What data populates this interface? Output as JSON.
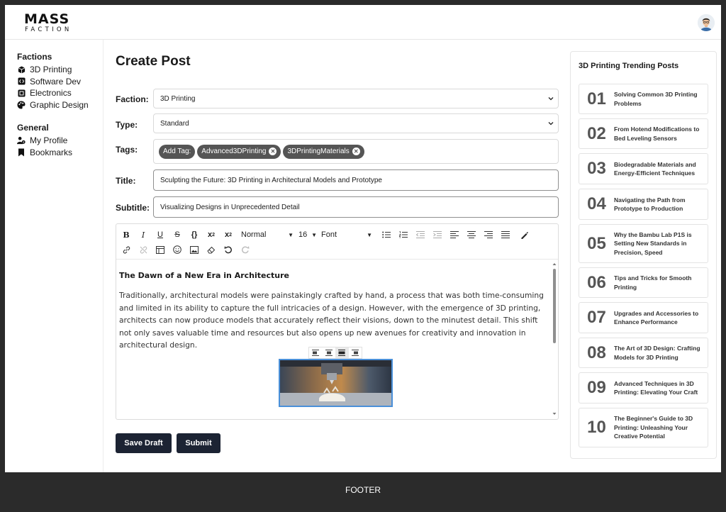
{
  "app": {
    "logo_line1": "MASS",
    "logo_line2": "FACTION"
  },
  "sidebar": {
    "factions_heading": "Factions",
    "factions": [
      {
        "label": "3D Printing",
        "icon": "cube-icon"
      },
      {
        "label": "Software Dev",
        "icon": "code-icon"
      },
      {
        "label": "Electronics",
        "icon": "chip-icon"
      },
      {
        "label": "Graphic Design",
        "icon": "palette-icon"
      }
    ],
    "general_heading": "General",
    "general": [
      {
        "label": "My Profile",
        "icon": "user-gear-icon"
      },
      {
        "label": "Bookmarks",
        "icon": "bookmark-icon"
      }
    ]
  },
  "form": {
    "page_title": "Create Post",
    "faction_label": "Faction:",
    "faction_value": "3D Printing",
    "type_label": "Type:",
    "type_value": "Standard",
    "tags_label": "Tags:",
    "add_tag_label": "Add Tag:",
    "tags": [
      "Advanced3DPrinting",
      "3DPrintingMaterials"
    ],
    "title_label": "Title:",
    "title_value": "Sculpting the Future: 3D Printing in Architectural Models and Prototype",
    "subtitle_label": "Subtitle:",
    "subtitle_value": "Visualizing Designs in Unprecedented Detail"
  },
  "toolbar": {
    "format_value": "Normal",
    "size_value": "16",
    "font_value": "Font"
  },
  "editor": {
    "heading": "The Dawn of a New Era in Architecture",
    "paragraph": "Traditionally, architectural models were painstakingly crafted by hand, a process that was both time-consuming and limited in its ability to capture the full intricacies of a design. However, with the emergence of 3D printing, architects can now produce models that accurately reflect their visions, down to the minutest detail. This shift not only saves valuable time and resources but also opens up new avenues for creativity and innovation in architectural design."
  },
  "actions": {
    "save_draft": "Save Draft",
    "submit": "Submit"
  },
  "trending": {
    "heading": "3D Printing Trending Posts",
    "items": [
      {
        "num": "01",
        "title": "Solving Common 3D Printing Problems"
      },
      {
        "num": "02",
        "title": "From Hotend Modifications to Bed Leveling Sensors"
      },
      {
        "num": "03",
        "title": "Biodegradable Materials and Energy-Efficient Techniques"
      },
      {
        "num": "04",
        "title": "Navigating the Path from Prototype to Production"
      },
      {
        "num": "05",
        "title": "Why the Bambu Lab P1S is Setting New Standards in Precision, Speed"
      },
      {
        "num": "06",
        "title": "Tips and Tricks for Smooth Printing"
      },
      {
        "num": "07",
        "title": "Upgrades and Accessories to Enhance Performance"
      },
      {
        "num": "08",
        "title": "The Art of 3D Design: Crafting Models for 3D Printing"
      },
      {
        "num": "09",
        "title": "Advanced Techniques in 3D Printing: Elevating Your Craft"
      },
      {
        "num": "10",
        "title": "The Beginner's Guide to 3D Printing: Unleashing Your Creative Potential"
      }
    ]
  },
  "footer": {
    "label": "FOOTER"
  },
  "colors": {
    "button_bg": "#1c2333",
    "tag_bg": "#555555",
    "footer_bg": "#2b2b2b",
    "image_selection": "#4a90d9"
  }
}
